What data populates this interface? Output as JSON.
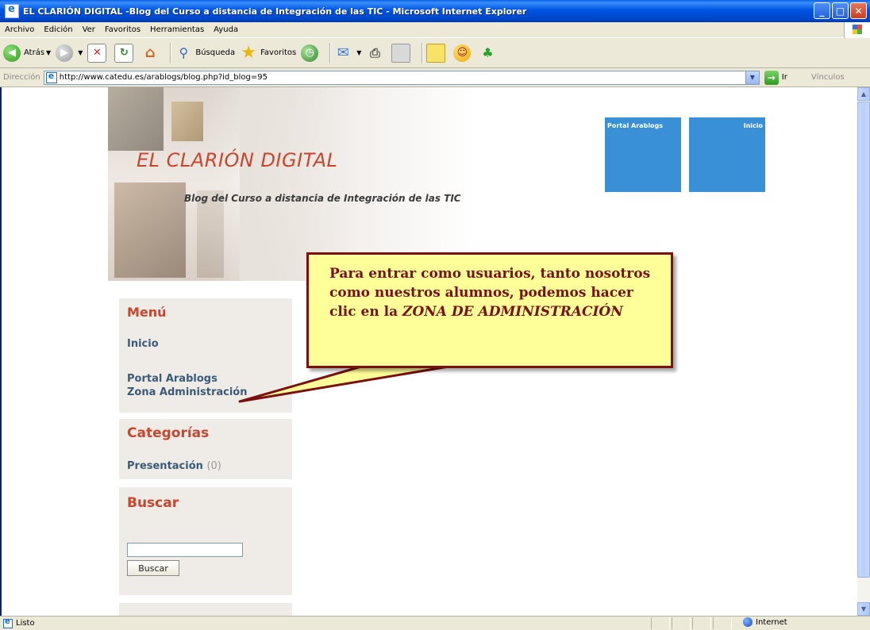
{
  "window": {
    "title": "EL CLARIÓN DIGITAL -Blog del Curso a distancia de Integración de las TIC - Microsoft Internet Explorer",
    "minimize": "_",
    "maximize": "□",
    "close": "✕"
  },
  "menubar": {
    "items": [
      "Archivo",
      "Edición",
      "Ver",
      "Favoritos",
      "Herramientas",
      "Ayuda"
    ]
  },
  "toolbar": {
    "back_label": "Atrás",
    "search_label": "Búsqueda",
    "favorites_label": "Favoritos"
  },
  "address": {
    "label": "Dirección",
    "url": "http://www.catedu.es/arablogs/blog.php?id_blog=95",
    "go_label": "Ir",
    "links_label": "Vínculos"
  },
  "page": {
    "site_title": "EL CLARIÓN DIGITAL",
    "site_subtitle": "Blog del Curso a distancia de Integración de las TIC",
    "topnav": {
      "portal": "Portal Arablogs",
      "inicio": "Inicio"
    },
    "menu": {
      "heading": "Menú",
      "items": [
        "Inicio",
        "Portal Arablogs",
        "Zona Administración"
      ]
    },
    "categories": {
      "heading": "Categorías",
      "items": [
        {
          "name": "Presentación",
          "count": "(0)"
        }
      ]
    },
    "search": {
      "heading": "Buscar",
      "button": "Buscar"
    }
  },
  "callout": {
    "text": "Para entrar como usuarios, tanto nosotros como nuestros alumnos, podemos hacer clic en la ",
    "emphasis": "ZONA DE ADMINISTRACIÓN"
  },
  "status": {
    "text": "Listo",
    "zone": "Internet"
  }
}
